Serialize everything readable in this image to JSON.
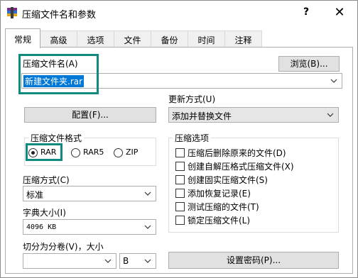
{
  "window": {
    "title": "压缩文件名和参数",
    "help_label": "?",
    "close_label": "✕"
  },
  "tabs": [
    {
      "label": "常规",
      "active": true
    },
    {
      "label": "高级"
    },
    {
      "label": "选项"
    },
    {
      "label": "文件"
    },
    {
      "label": "备份"
    },
    {
      "label": "时间"
    },
    {
      "label": "注释"
    }
  ],
  "archive_name": {
    "label": "压缩文件名(A)",
    "value": "新建文件夹.rar",
    "browse_label": "浏览(B)..."
  },
  "update_mode": {
    "label": "更新方式(U)",
    "value": "添加并替换文件"
  },
  "profiles_label": "配置(F)...",
  "archive_format": {
    "label": "压缩文件格式",
    "options": [
      "RAR",
      "RAR5",
      "ZIP"
    ],
    "selected": "RAR"
  },
  "compression_method": {
    "label": "压缩方式(C)",
    "value": "标准"
  },
  "dictionary_size": {
    "label": "字典大小(I)",
    "value": "4096 KB"
  },
  "split_volumes": {
    "label": "切分为分卷(V)，大小",
    "value": "",
    "unit": "B"
  },
  "archive_options": {
    "label": "压缩选项",
    "items": [
      "压缩后删除原来的文件(D)",
      "创建自解压格式压缩文件(X)",
      "创建固实压缩文件(S)",
      "添加恢复记录(E)",
      "测试压缩的文件(T)",
      "锁定压缩文件(L)"
    ]
  },
  "set_password_label": "设置密码(P)...",
  "colors": {
    "highlight": "#0f8a7e",
    "selection": "#0078d7"
  }
}
